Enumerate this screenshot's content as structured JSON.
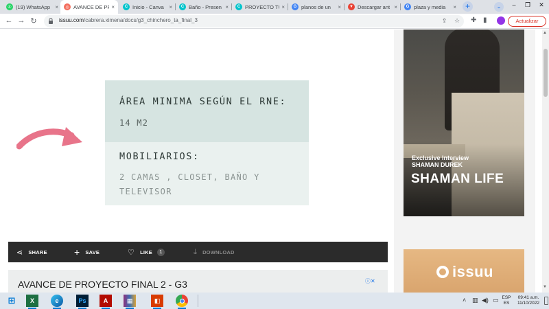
{
  "browser": {
    "tabs": [
      {
        "title": "(19) WhatsApp",
        "favicon": "whatsapp-icon",
        "color": "#25d366"
      },
      {
        "title": "AVANCE DE PR",
        "favicon": "issuu-icon",
        "color": "#f36d5d",
        "active": true
      },
      {
        "title": "Inicio - Canva",
        "favicon": "canva-icon",
        "color": "#00c4cc"
      },
      {
        "title": "Baño - Presen",
        "favicon": "canva-icon",
        "color": "#00c4cc"
      },
      {
        "title": "PROYECTO TU",
        "favicon": "canva-icon",
        "color": "#00c4cc"
      },
      {
        "title": "planos de un",
        "favicon": "google-icon",
        "color": "#4285f4"
      },
      {
        "title": "Descargar ant",
        "favicon": "download-site-icon",
        "color": "#e94235"
      },
      {
        "title": "plaza y media",
        "favicon": "google-icon",
        "color": "#4285f4"
      }
    ],
    "url_host": "issuu.com",
    "url_path": "/cabrera.ximena/docs/g3_chinchero_ta_final_3",
    "update_button": "Actualizar"
  },
  "document": {
    "area_heading": "ÁREA MINIMA SEGÚN EL RNE:",
    "area_value": "14 M2",
    "mob_heading": "MOBILIARIOS:",
    "mob_value": "2 CAMAS , CLOSET, BAÑO Y TELEVISOR",
    "colors": {
      "top_band": "#d6e4e1",
      "bottom_band": "#eaf1ef",
      "arrow": "#e8748a"
    }
  },
  "actions": {
    "share": "SHARE",
    "save": "SAVE",
    "like": "LIKE",
    "like_count": "1",
    "download": "DOWNLOAD"
  },
  "ad": {
    "title": "AVANCE DE PROYECTO FINAL 2 - G3"
  },
  "sidebar": {
    "promo_kicker": "Exclusive Interview",
    "promo_name": "SHAMAN DUREK",
    "promo_big": "SHAMAN LIFE",
    "promo2_logo": "issuu"
  },
  "taskbar": {
    "apps": [
      "start",
      "search",
      "excel",
      "edge",
      "photoshop",
      "acrobat",
      "winrar",
      "office",
      "chrome",
      "explorer"
    ],
    "lang_top": "ESP",
    "lang_bottom": "ES",
    "time": "09:41 a.m.",
    "date": "11/10/2022"
  }
}
